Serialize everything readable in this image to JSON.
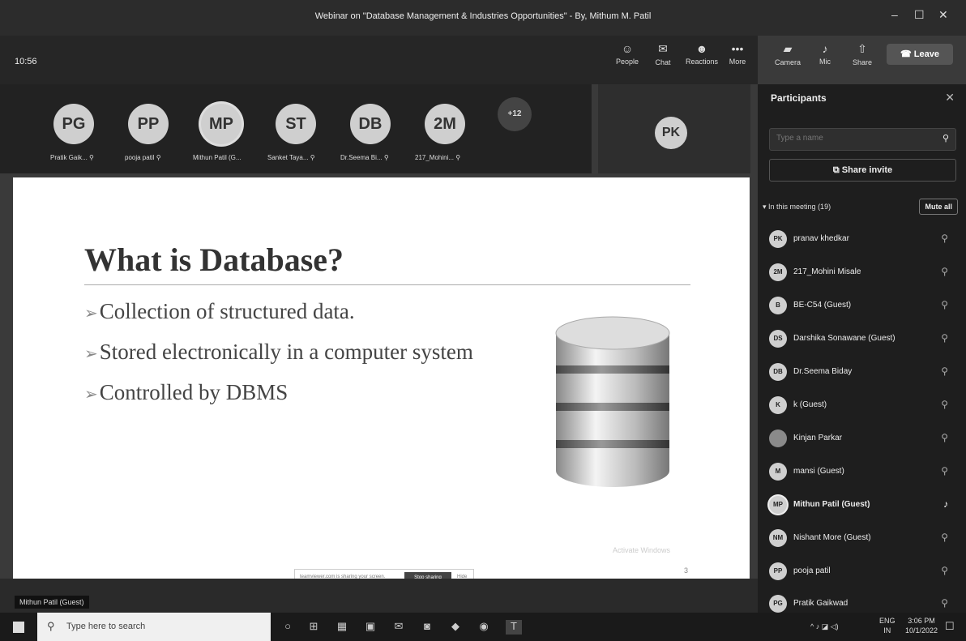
{
  "window": {
    "title": "Webinar on \"Database Management & Industries Opportunities\" - By, Mithum M. Patil",
    "minimize": "–",
    "maximize": "☐",
    "close": "✕"
  },
  "meeting": {
    "clock": "10:56",
    "toolbar": [
      {
        "label": "People",
        "icon": "people-icon",
        "glyph": "☺"
      },
      {
        "label": "Chat",
        "icon": "chat-icon",
        "glyph": "✉"
      },
      {
        "label": "Reactions",
        "icon": "reactions-icon",
        "glyph": "☻"
      },
      {
        "label": "More",
        "icon": "more-icon",
        "glyph": "•••"
      },
      {
        "label": "Camera",
        "icon": "camera-off-icon",
        "glyph": "▰"
      },
      {
        "label": "Mic",
        "icon": "mic-off-icon",
        "glyph": "♪"
      },
      {
        "label": "Share",
        "icon": "share-icon",
        "glyph": "⇧"
      }
    ],
    "leave_label": "Leave",
    "video_strip": [
      {
        "initials": "PG",
        "name": "Pratik Gaik...",
        "mic": "⚲"
      },
      {
        "initials": "PP",
        "name": "pooja patil",
        "mic": "⚲"
      },
      {
        "initials": "MP",
        "name": "Mithun Patil (G...",
        "mic": ""
      },
      {
        "initials": "ST",
        "name": "Sanket Taya...",
        "mic": "⚲"
      },
      {
        "initials": "DB",
        "name": "Dr.Seema Bi...",
        "mic": "⚲"
      },
      {
        "initials": "2M",
        "name": "217_Mohini...",
        "mic": "⚲"
      }
    ],
    "overflow_count": "+12",
    "pinned_initials": "PK",
    "presenter_label": "Mithun Patil (Guest)"
  },
  "slide": {
    "title": "What is Database?",
    "bullets": [
      "Collection of structured data.",
      "Stored electronically in a computer system",
      "Controlled by DBMS"
    ],
    "bullet_marker": "➢",
    "page_number": "3",
    "watermark": "Activate Windows"
  },
  "share_bar": {
    "text": "teamviewer.com is sharing your screen.",
    "stop_label": "Stop sharing",
    "hide_label": "Hide"
  },
  "panel": {
    "title": "Participants",
    "search_placeholder": "Type a name",
    "share_invite": "Share invite",
    "in_meeting": "In this meeting (19)",
    "mute_all": "Mute all",
    "participants": [
      {
        "initials": "PK",
        "name": "pranav khedkar",
        "bold": false
      },
      {
        "initials": "2M",
        "name": "217_Mohini Misale",
        "bold": false
      },
      {
        "initials": "B",
        "name": "BE-C54 (Guest)",
        "bold": false
      },
      {
        "initials": "DS",
        "name": "Darshika Sonawane (Guest)",
        "bold": false
      },
      {
        "initials": "DB",
        "name": "Dr.Seema Biday",
        "bold": false
      },
      {
        "initials": "K",
        "name": "k (Guest)",
        "bold": false
      },
      {
        "initials": "",
        "name": "Kinjan Parkar",
        "bold": false
      },
      {
        "initials": "M",
        "name": "mansi (Guest)",
        "bold": false
      },
      {
        "initials": "MP",
        "name": "Mithun Patil (Guest)",
        "bold": true
      },
      {
        "initials": "NM",
        "name": "Nishant More (Guest)",
        "bold": false
      },
      {
        "initials": "PP",
        "name": "pooja patil",
        "bold": false
      },
      {
        "initials": "PG",
        "name": "Pratik Gaikwad",
        "bold": false
      }
    ]
  },
  "taskbar": {
    "search_placeholder": "Type here to search",
    "apps": [
      "○",
      "⊞",
      "▦",
      "▣",
      "✉",
      "◙",
      "◆",
      "◉",
      "T"
    ],
    "tray": {
      "icons": "^ ♪ ◪ ◁)",
      "lang": "ENG",
      "region": "IN",
      "time": "3:06 PM",
      "date": "10/1/2022"
    }
  }
}
